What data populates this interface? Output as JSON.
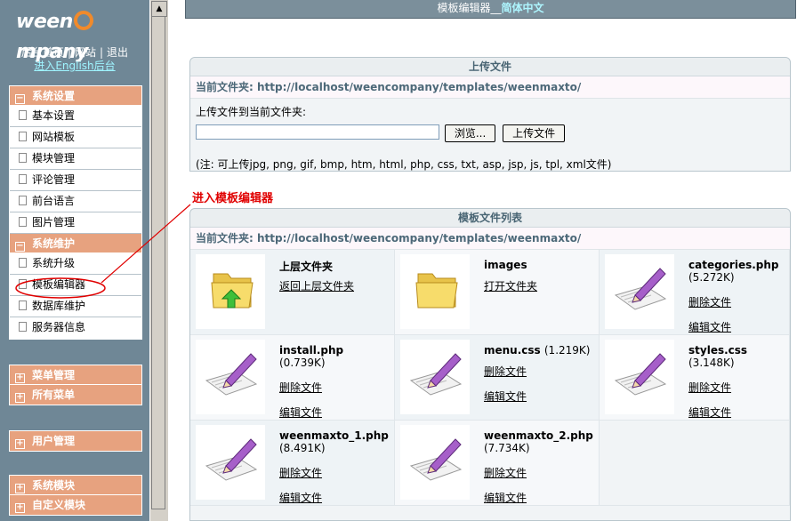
{
  "sidebar": {
    "logo_left": "ween",
    "logo_right": "mpany",
    "links": [
      "后台首页",
      "网站",
      "退出"
    ],
    "english_link": "进入English后台",
    "groups": [
      {
        "title": "系统设置",
        "items": [
          "基本设置",
          "网站模板",
          "模块管理",
          "评论管理",
          "前台语言",
          "图片管理"
        ]
      },
      {
        "title": "系统维护",
        "items": [
          "系统升级",
          "模板编辑器",
          "数据库维护",
          "服务器信息"
        ]
      }
    ],
    "collapsed": [
      "菜单管理",
      "所有菜单",
      "用户管理",
      "系统模块",
      "自定义模块"
    ]
  },
  "topbar": {
    "title": "模板编辑器__",
    "lang": "简体中文"
  },
  "upload": {
    "title": "上传文件",
    "path_label": "当前文件夹:",
    "path": "http://localhost/weencompany/templates/weenmaxto/",
    "prompt": "上传文件到当前文件夹:",
    "browse": "浏览...",
    "submit": "上传文件",
    "note": "(注: 可上传jpg, png, gif, bmp, htm, html, php, css, txt, asp, jsp, js, tpl, xml文件)"
  },
  "annotation": "进入模板编辑器",
  "filelist": {
    "title": "模板文件列表",
    "path_label": "当前文件夹:",
    "path": "http://localhost/weencompany/templates/weenmaxto/",
    "delete_label": "删除文件",
    "edit_label": "编辑文件",
    "entries": [
      {
        "kind": "parent",
        "name": "上层文件夹",
        "action": "返回上层文件夹"
      },
      {
        "kind": "folder",
        "name": "images",
        "action": "打开文件夹"
      },
      {
        "kind": "file",
        "name": "categories.php",
        "size": "(5.272K)"
      },
      {
        "kind": "file",
        "name": "install.php",
        "size": "(0.739K)"
      },
      {
        "kind": "file",
        "name": "menu.css",
        "size": "(1.219K)"
      },
      {
        "kind": "file",
        "name": "styles.css",
        "size": "(3.148K)"
      },
      {
        "kind": "file",
        "name": "weenmaxto_1.php",
        "size": "(8.491K)"
      },
      {
        "kind": "file",
        "name": "weenmaxto_2.php",
        "size": "(7.734K)"
      }
    ]
  },
  "colors": {
    "sidebar_bg": "#6f8796",
    "menu_head": "#e7a27f",
    "annotation": "#e00000",
    "path_text": "#4c6878"
  }
}
